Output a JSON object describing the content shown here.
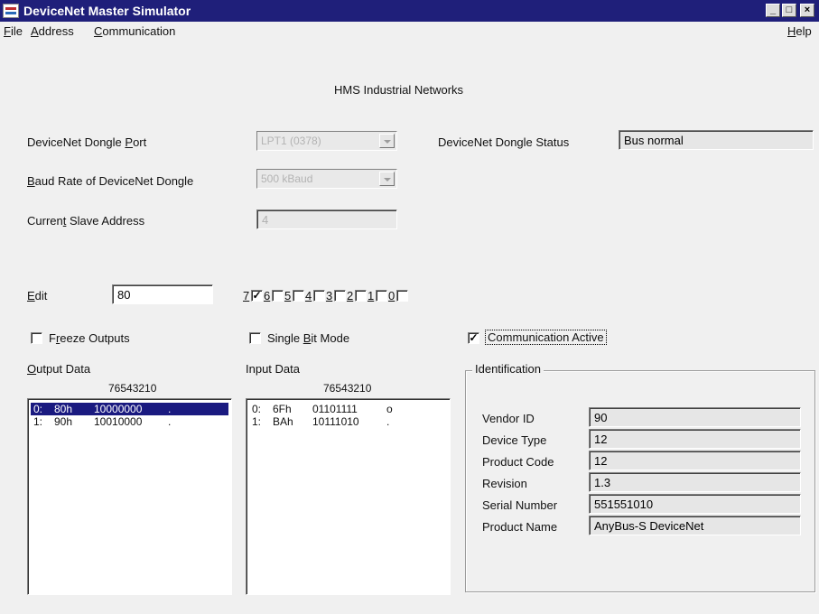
{
  "window": {
    "title": "DeviceNet Master Simulator"
  },
  "titlebar": {
    "min": "_",
    "max": "□",
    "close": "×"
  },
  "menu": [
    {
      "label": "File",
      "key": "F",
      "rest": "ile"
    },
    {
      "label": "Address",
      "key": "A",
      "rest": "ddress"
    },
    {
      "label": "Communication",
      "key": "C",
      "rest": "ommunication"
    }
  ],
  "help_menu": {
    "key": "H",
    "rest": "elp"
  },
  "header": {
    "company": "HMS Industrial Networks"
  },
  "dongle_port": {
    "label_pre": "DeviceNet Dongle ",
    "label_key": "P",
    "label_post": "ort",
    "value": "LPT1 (0378)"
  },
  "dongle_status": {
    "label": "DeviceNet Dongle Status",
    "value": "Bus normal"
  },
  "baud_rate": {
    "label_key": "B",
    "label_post": "aud Rate of DeviceNet Dongle",
    "value": "500 kBaud"
  },
  "slave_address": {
    "label_pre": "Curren",
    "label_key": "t",
    "label_post": " Slave Address",
    "value": "4"
  },
  "edit": {
    "label_key": "E",
    "label_post": "dit",
    "value": "80"
  },
  "bits": [
    {
      "label": "7",
      "checked": true
    },
    {
      "label": "6",
      "checked": false
    },
    {
      "label": "5",
      "checked": false
    },
    {
      "label": "4",
      "checked": false
    },
    {
      "label": "3",
      "checked": false
    },
    {
      "label": "2",
      "checked": false
    },
    {
      "label": "1",
      "checked": false
    },
    {
      "label": "0",
      "checked": false
    }
  ],
  "freeze_outputs": {
    "label_pre": "F",
    "label_key": "r",
    "label_post": "eeze Outputs",
    "checked": false
  },
  "single_bit_mode": {
    "label_pre": "Single ",
    "label_key": "B",
    "label_post": "it Mode",
    "checked": false
  },
  "communication_active": {
    "label": "Communication Active",
    "checked": true
  },
  "output_data": {
    "label_key": "O",
    "label_post": "utput Data",
    "header": "76543210",
    "rows": [
      {
        "idx": "0:",
        "hex": "80h",
        "bin": "10000000",
        "ch": ".",
        "selected": true
      },
      {
        "idx": "1:",
        "hex": "90h",
        "bin": "10010000",
        "ch": ".",
        "selected": false
      }
    ]
  },
  "input_data": {
    "label": "Input Data",
    "header": "76543210",
    "rows": [
      {
        "idx": "0:",
        "hex": "6Fh",
        "bin": "01101111",
        "ch": "o"
      },
      {
        "idx": "1:",
        "hex": "BAh",
        "bin": "10111010",
        "ch": "."
      }
    ]
  },
  "identification": {
    "title": "Identification",
    "fields": [
      {
        "label": "Vendor ID",
        "value": "90"
      },
      {
        "label": "Device Type",
        "value": "12"
      },
      {
        "label": "Product Code",
        "value": "12"
      },
      {
        "label": "Revision",
        "value": "1.3"
      },
      {
        "label": "Serial Number",
        "value": "551551010"
      },
      {
        "label": "Product Name",
        "value": "AnyBus-S DeviceNet"
      }
    ]
  },
  "check_mark": "✓",
  "icons": {
    "app": "devicenet-app-icon",
    "minimize": "minimize-icon",
    "maximize": "maximize-icon",
    "close": "close-icon",
    "dropdown": "chevron-down-icon"
  }
}
